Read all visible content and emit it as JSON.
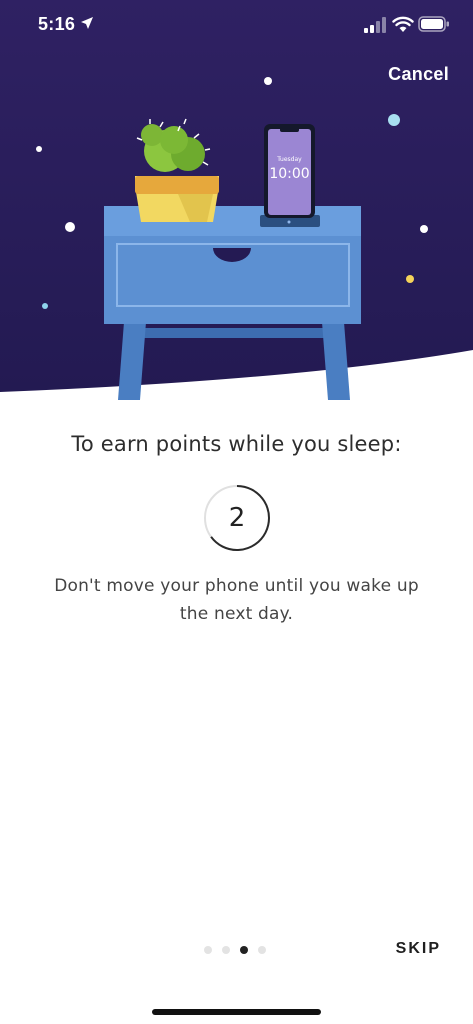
{
  "status_bar": {
    "time": "5:16",
    "icons": [
      "location-arrow-icon",
      "cellular-signal-icon",
      "wifi-icon",
      "battery-icon"
    ]
  },
  "header": {
    "cancel_label": "Cancel"
  },
  "illustration": {
    "phone_day": "Tuesday",
    "phone_time": "10:00"
  },
  "content": {
    "heading": "To earn points while you sleep:",
    "step_number": "2",
    "instruction": "Don't move your phone until you wake up the next day."
  },
  "pager": {
    "total": 4,
    "active_index": 2
  },
  "footer": {
    "skip_label": "SKIP"
  },
  "colors": {
    "night_sky": "#2a1d5c",
    "table_blue": "#5a8fcf",
    "progress_ring": "#2b2b2b",
    "ring_track": "#e0e0e0"
  }
}
